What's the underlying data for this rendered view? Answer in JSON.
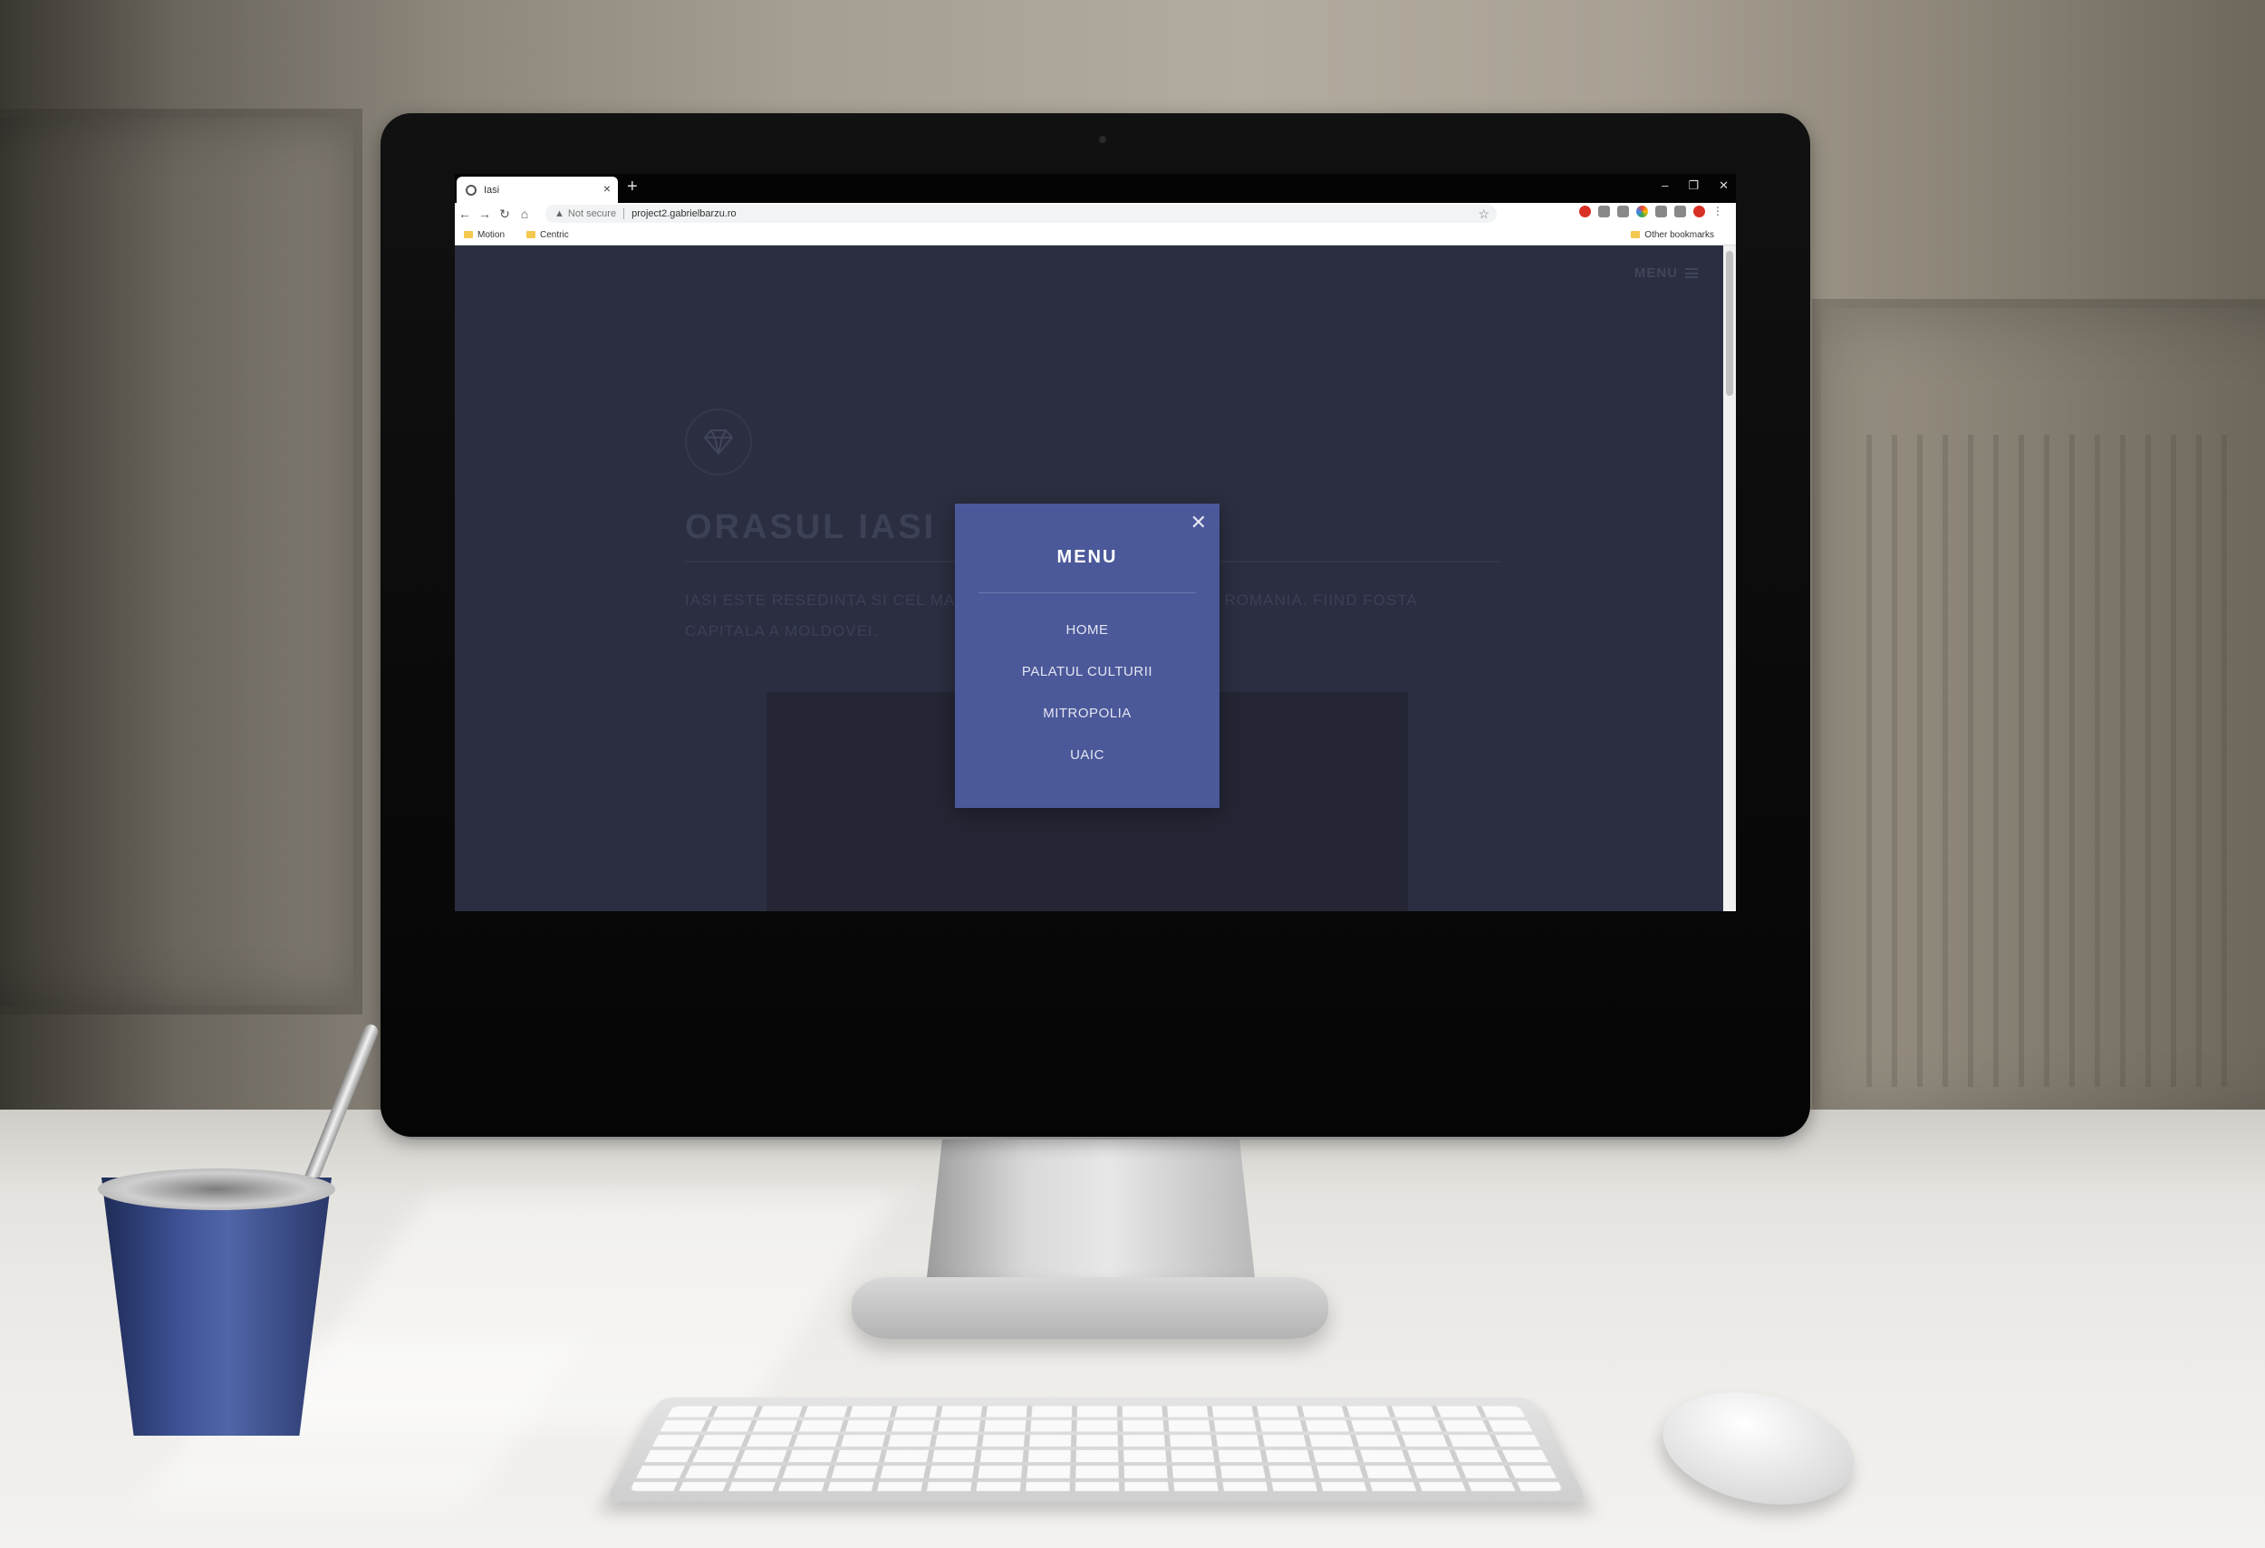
{
  "browser": {
    "tab_title": "Iasi",
    "new_tab": "+",
    "window_controls": [
      "–",
      "❐",
      "✕"
    ],
    "address": {
      "security_label": "Not secure",
      "url": "project2.gabrielbarzu.ro"
    },
    "bookmarks": [
      "Motion",
      "Centric"
    ],
    "other_bookmarks": "Other bookmarks"
  },
  "page": {
    "menu_button_label": "MENU",
    "hero_title": "ORASUL IASI",
    "hero_text_left": "IASI ESTE RESEDINTA SI CEL MAI",
    "hero_text_right": "ROMANIA. FIIND FOSTA",
    "hero_text_line2": "CAPITALA A MOLDOVEI."
  },
  "modal": {
    "title": "MENU",
    "items": [
      "HOME",
      "PALATUL CULTURII",
      "MITROPOLIA",
      "UAIC"
    ]
  },
  "colors": {
    "page_bg": "#2f3345",
    "modal_bg": "#4b5899",
    "cup": "#3f5396"
  }
}
